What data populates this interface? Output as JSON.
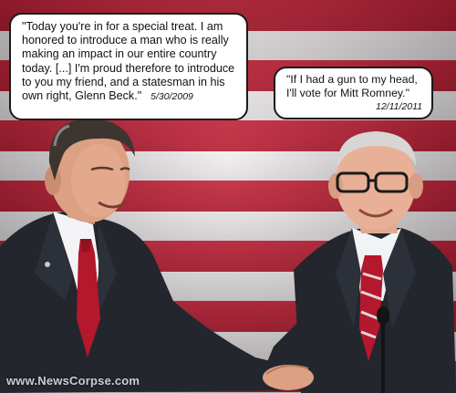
{
  "quotes": {
    "left": {
      "text": "\"Today you're in for a special treat. I am honored to introduce a man who is really making an impact in our entire country today. [...] I'm proud therefore to introduce to you my friend, and a statesman in his own right, Glenn Beck.\"",
      "date": "5/30/2009"
    },
    "right": {
      "text": "\"If I had a gun to my head, I'll vote for Mitt Romney.\"",
      "date": "12/11/2011"
    }
  },
  "watermark": "www.NewsCorpse.com",
  "colors": {
    "flag_red": "#c8243a",
    "flag_white": "#f3f0f1",
    "suit": "#23262d",
    "tie_red": "#b3182c"
  }
}
